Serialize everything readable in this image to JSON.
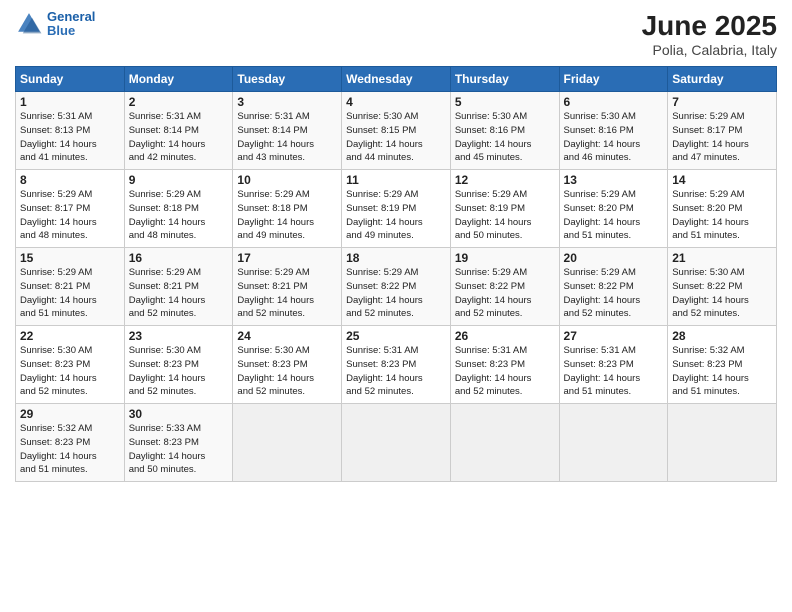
{
  "logo": {
    "line1": "General",
    "line2": "Blue"
  },
  "title": "June 2025",
  "subtitle": "Polia, Calabria, Italy",
  "days_header": [
    "Sunday",
    "Monday",
    "Tuesday",
    "Wednesday",
    "Thursday",
    "Friday",
    "Saturday"
  ],
  "weeks": [
    [
      {
        "num": "1",
        "lines": [
          "Sunrise: 5:31 AM",
          "Sunset: 8:13 PM",
          "Daylight: 14 hours",
          "and 41 minutes."
        ]
      },
      {
        "num": "2",
        "lines": [
          "Sunrise: 5:31 AM",
          "Sunset: 8:14 PM",
          "Daylight: 14 hours",
          "and 42 minutes."
        ]
      },
      {
        "num": "3",
        "lines": [
          "Sunrise: 5:31 AM",
          "Sunset: 8:14 PM",
          "Daylight: 14 hours",
          "and 43 minutes."
        ]
      },
      {
        "num": "4",
        "lines": [
          "Sunrise: 5:30 AM",
          "Sunset: 8:15 PM",
          "Daylight: 14 hours",
          "and 44 minutes."
        ]
      },
      {
        "num": "5",
        "lines": [
          "Sunrise: 5:30 AM",
          "Sunset: 8:16 PM",
          "Daylight: 14 hours",
          "and 45 minutes."
        ]
      },
      {
        "num": "6",
        "lines": [
          "Sunrise: 5:30 AM",
          "Sunset: 8:16 PM",
          "Daylight: 14 hours",
          "and 46 minutes."
        ]
      },
      {
        "num": "7",
        "lines": [
          "Sunrise: 5:29 AM",
          "Sunset: 8:17 PM",
          "Daylight: 14 hours",
          "and 47 minutes."
        ]
      }
    ],
    [
      {
        "num": "8",
        "lines": [
          "Sunrise: 5:29 AM",
          "Sunset: 8:17 PM",
          "Daylight: 14 hours",
          "and 48 minutes."
        ]
      },
      {
        "num": "9",
        "lines": [
          "Sunrise: 5:29 AM",
          "Sunset: 8:18 PM",
          "Daylight: 14 hours",
          "and 48 minutes."
        ]
      },
      {
        "num": "10",
        "lines": [
          "Sunrise: 5:29 AM",
          "Sunset: 8:18 PM",
          "Daylight: 14 hours",
          "and 49 minutes."
        ]
      },
      {
        "num": "11",
        "lines": [
          "Sunrise: 5:29 AM",
          "Sunset: 8:19 PM",
          "Daylight: 14 hours",
          "and 49 minutes."
        ]
      },
      {
        "num": "12",
        "lines": [
          "Sunrise: 5:29 AM",
          "Sunset: 8:19 PM",
          "Daylight: 14 hours",
          "and 50 minutes."
        ]
      },
      {
        "num": "13",
        "lines": [
          "Sunrise: 5:29 AM",
          "Sunset: 8:20 PM",
          "Daylight: 14 hours",
          "and 51 minutes."
        ]
      },
      {
        "num": "14",
        "lines": [
          "Sunrise: 5:29 AM",
          "Sunset: 8:20 PM",
          "Daylight: 14 hours",
          "and 51 minutes."
        ]
      }
    ],
    [
      {
        "num": "15",
        "lines": [
          "Sunrise: 5:29 AM",
          "Sunset: 8:21 PM",
          "Daylight: 14 hours",
          "and 51 minutes."
        ]
      },
      {
        "num": "16",
        "lines": [
          "Sunrise: 5:29 AM",
          "Sunset: 8:21 PM",
          "Daylight: 14 hours",
          "and 52 minutes."
        ]
      },
      {
        "num": "17",
        "lines": [
          "Sunrise: 5:29 AM",
          "Sunset: 8:21 PM",
          "Daylight: 14 hours",
          "and 52 minutes."
        ]
      },
      {
        "num": "18",
        "lines": [
          "Sunrise: 5:29 AM",
          "Sunset: 8:22 PM",
          "Daylight: 14 hours",
          "and 52 minutes."
        ]
      },
      {
        "num": "19",
        "lines": [
          "Sunrise: 5:29 AM",
          "Sunset: 8:22 PM",
          "Daylight: 14 hours",
          "and 52 minutes."
        ]
      },
      {
        "num": "20",
        "lines": [
          "Sunrise: 5:29 AM",
          "Sunset: 8:22 PM",
          "Daylight: 14 hours",
          "and 52 minutes."
        ]
      },
      {
        "num": "21",
        "lines": [
          "Sunrise: 5:30 AM",
          "Sunset: 8:22 PM",
          "Daylight: 14 hours",
          "and 52 minutes."
        ]
      }
    ],
    [
      {
        "num": "22",
        "lines": [
          "Sunrise: 5:30 AM",
          "Sunset: 8:23 PM",
          "Daylight: 14 hours",
          "and 52 minutes."
        ]
      },
      {
        "num": "23",
        "lines": [
          "Sunrise: 5:30 AM",
          "Sunset: 8:23 PM",
          "Daylight: 14 hours",
          "and 52 minutes."
        ]
      },
      {
        "num": "24",
        "lines": [
          "Sunrise: 5:30 AM",
          "Sunset: 8:23 PM",
          "Daylight: 14 hours",
          "and 52 minutes."
        ]
      },
      {
        "num": "25",
        "lines": [
          "Sunrise: 5:31 AM",
          "Sunset: 8:23 PM",
          "Daylight: 14 hours",
          "and 52 minutes."
        ]
      },
      {
        "num": "26",
        "lines": [
          "Sunrise: 5:31 AM",
          "Sunset: 8:23 PM",
          "Daylight: 14 hours",
          "and 52 minutes."
        ]
      },
      {
        "num": "27",
        "lines": [
          "Sunrise: 5:31 AM",
          "Sunset: 8:23 PM",
          "Daylight: 14 hours",
          "and 51 minutes."
        ]
      },
      {
        "num": "28",
        "lines": [
          "Sunrise: 5:32 AM",
          "Sunset: 8:23 PM",
          "Daylight: 14 hours",
          "and 51 minutes."
        ]
      }
    ],
    [
      {
        "num": "29",
        "lines": [
          "Sunrise: 5:32 AM",
          "Sunset: 8:23 PM",
          "Daylight: 14 hours",
          "and 51 minutes."
        ]
      },
      {
        "num": "30",
        "lines": [
          "Sunrise: 5:33 AM",
          "Sunset: 8:23 PM",
          "Daylight: 14 hours",
          "and 50 minutes."
        ]
      },
      {
        "num": "",
        "lines": []
      },
      {
        "num": "",
        "lines": []
      },
      {
        "num": "",
        "lines": []
      },
      {
        "num": "",
        "lines": []
      },
      {
        "num": "",
        "lines": []
      }
    ]
  ]
}
